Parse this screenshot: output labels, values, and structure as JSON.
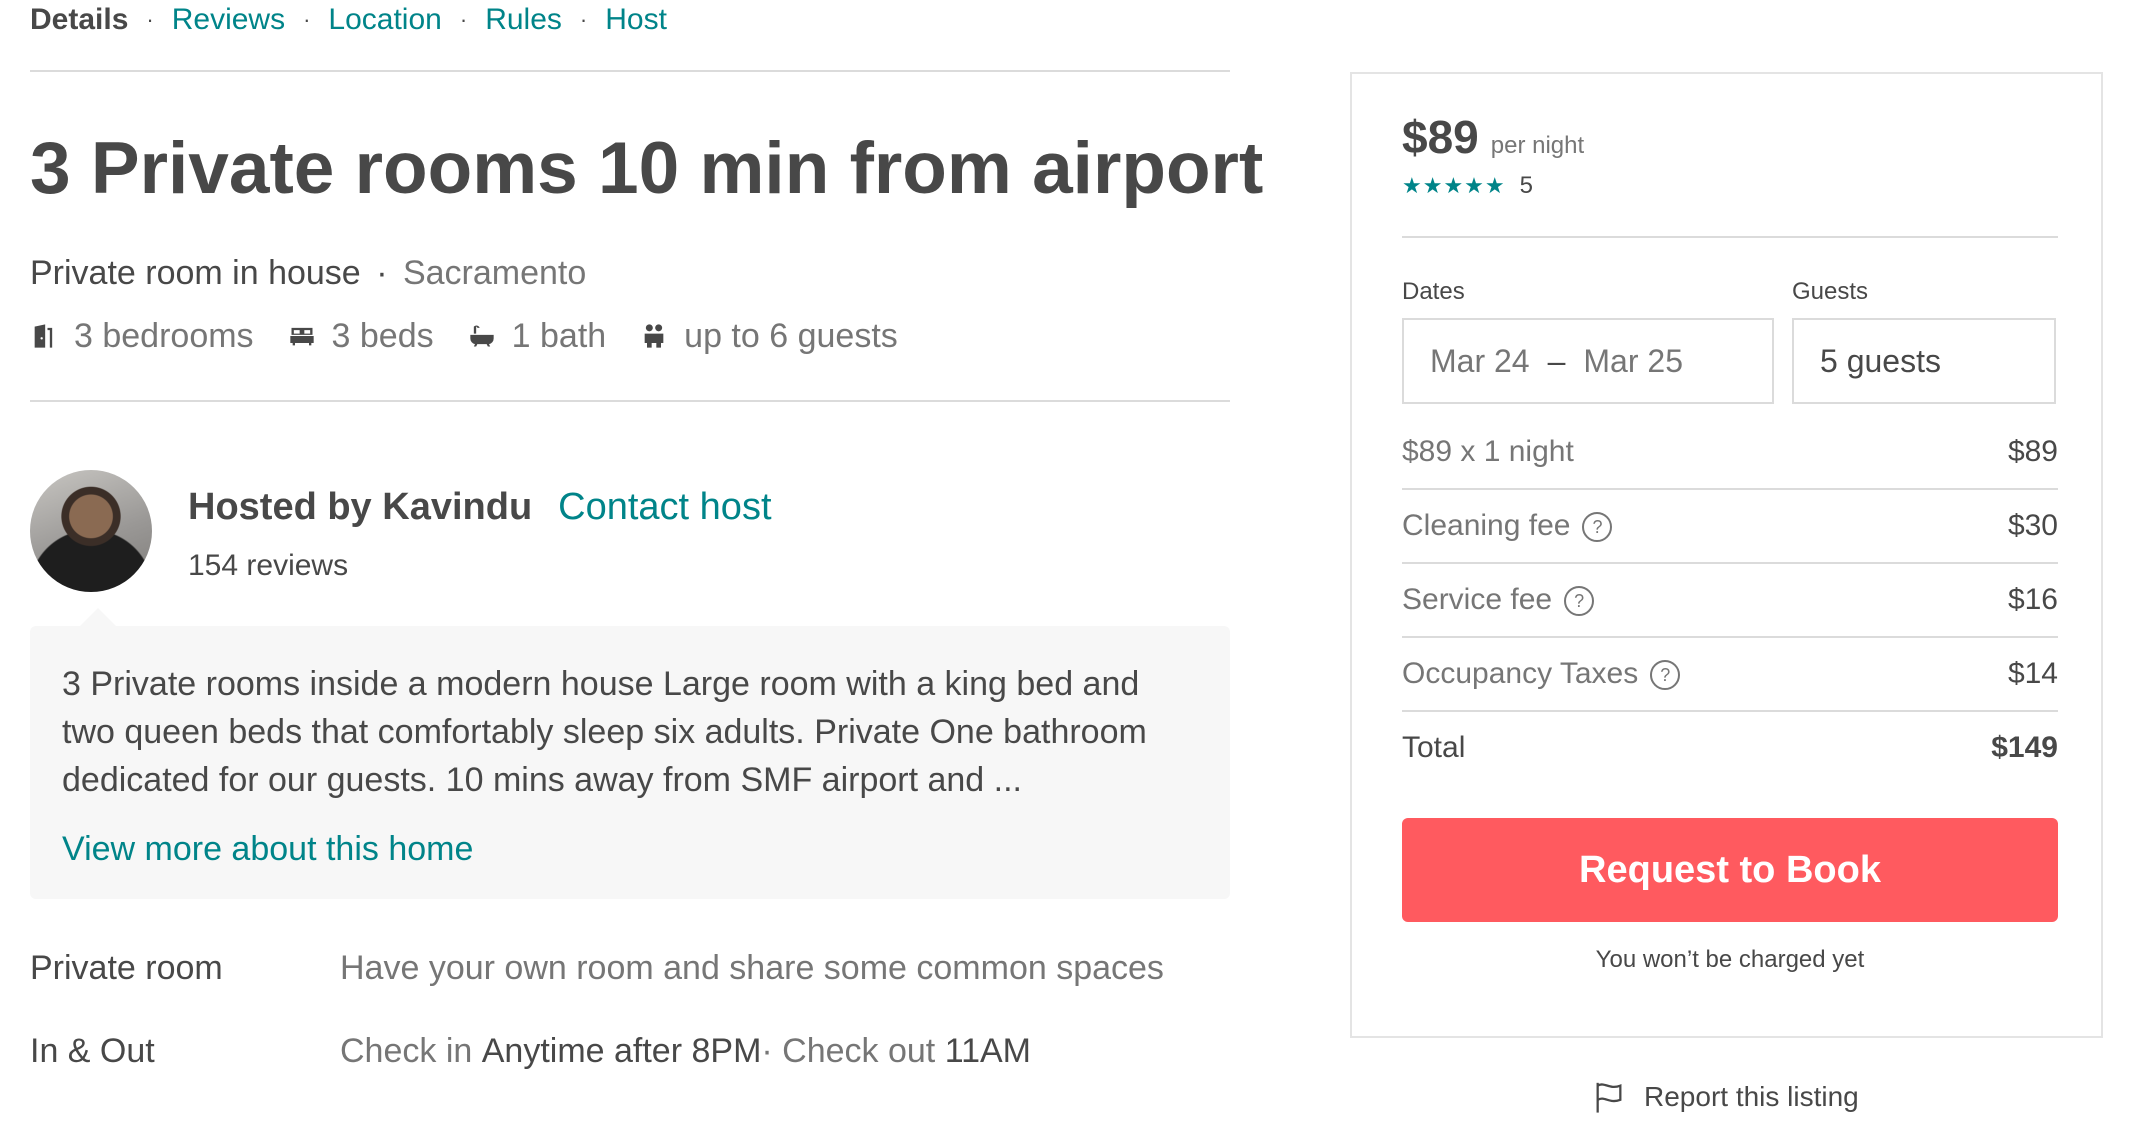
{
  "subnav": {
    "active": "Details",
    "links": [
      "Reviews",
      "Location",
      "Rules",
      "Host"
    ],
    "separator": "·"
  },
  "listing": {
    "title": "3 Private rooms 10 min from airport",
    "room_type": "Private room in house",
    "separator": "·",
    "city": "Sacramento",
    "amenities": {
      "bedrooms": "3 bedrooms",
      "beds": "3 beds",
      "baths": "1 bath",
      "guests": "up to 6 guests"
    }
  },
  "host": {
    "hosted_by": "Hosted by Kavindu",
    "contact": "Contact host",
    "reviews": "154 reviews"
  },
  "description": {
    "text": "3 Private rooms inside a modern house Large room with a king bed and two queen beds that comfortably sleep six adults. Private One bathroom dedicated for our guests. 10 mins away from SMF airport and ...",
    "view_more": "View more about this home"
  },
  "details": {
    "room_label": "Private room",
    "room_value": "Have your own room and share some common spaces",
    "inout_label": "In & Out",
    "check_in_prefix": "Check in ",
    "check_in_value": "Anytime after 8PM",
    "check_out_prefix": "· Check out ",
    "check_out_value": "11AM"
  },
  "booking": {
    "price": "$89",
    "per_night": "per night",
    "stars": "★★★★★",
    "rating_count": "5",
    "dates_label": "Dates",
    "guests_label": "Guests",
    "check_in": "Mar 24",
    "dash": "–",
    "check_out": "Mar 25",
    "guests_value": "5 guests",
    "fees": {
      "nightly_label": "$89 x 1 night",
      "nightly_amount": "$89",
      "cleaning_label": "Cleaning fee",
      "cleaning_amount": "$30",
      "service_label": "Service fee",
      "service_amount": "$16",
      "taxes_label": "Occupancy Taxes",
      "taxes_amount": "$14",
      "total_label": "Total",
      "total_amount": "$149"
    },
    "help_glyph": "?",
    "book_button": "Request to Book",
    "no_charge": "You won’t be charged yet"
  },
  "report": {
    "label": "Report this listing"
  },
  "colors": {
    "accent_teal": "#008489",
    "button_coral": "#ff5a5f",
    "text_dark": "#484848",
    "text_muted": "#767676"
  }
}
